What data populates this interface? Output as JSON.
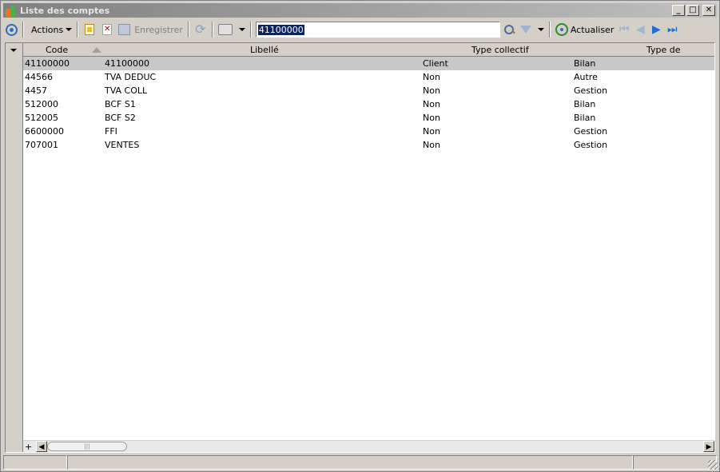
{
  "window": {
    "title": "Liste des comptes"
  },
  "toolbar": {
    "actions_label": "Actions",
    "save_label": "Enregistrer",
    "refresh_label": "Actualiser",
    "search_value": "41100000"
  },
  "grid": {
    "columns": [
      "Code",
      "Libellé",
      "Type collectif",
      "Type de compte"
    ],
    "rows": [
      {
        "code": "41100000",
        "libelle": "41100000",
        "collectif": "Client",
        "type": "Bilan"
      },
      {
        "code": "44566",
        "libelle": "TVA DEDUC",
        "collectif": "Non",
        "type": "Autre"
      },
      {
        "code": "4457",
        "libelle": "TVA COLL",
        "collectif": "Non",
        "type": "Gestion"
      },
      {
        "code": "512000",
        "libelle": "BCF S1",
        "collectif": "Non",
        "type": "Bilan"
      },
      {
        "code": "512005",
        "libelle": "BCF S2",
        "collectif": "Non",
        "type": "Bilan"
      },
      {
        "code": "6600000",
        "libelle": "FFI",
        "collectif": "Non",
        "type": "Gestion"
      },
      {
        "code": "707001",
        "libelle": "VENTES",
        "collectif": "Non",
        "type": "Gestion"
      }
    ]
  },
  "scrollbar": {
    "plus_label": "+",
    "thumb_grip": "|||"
  }
}
